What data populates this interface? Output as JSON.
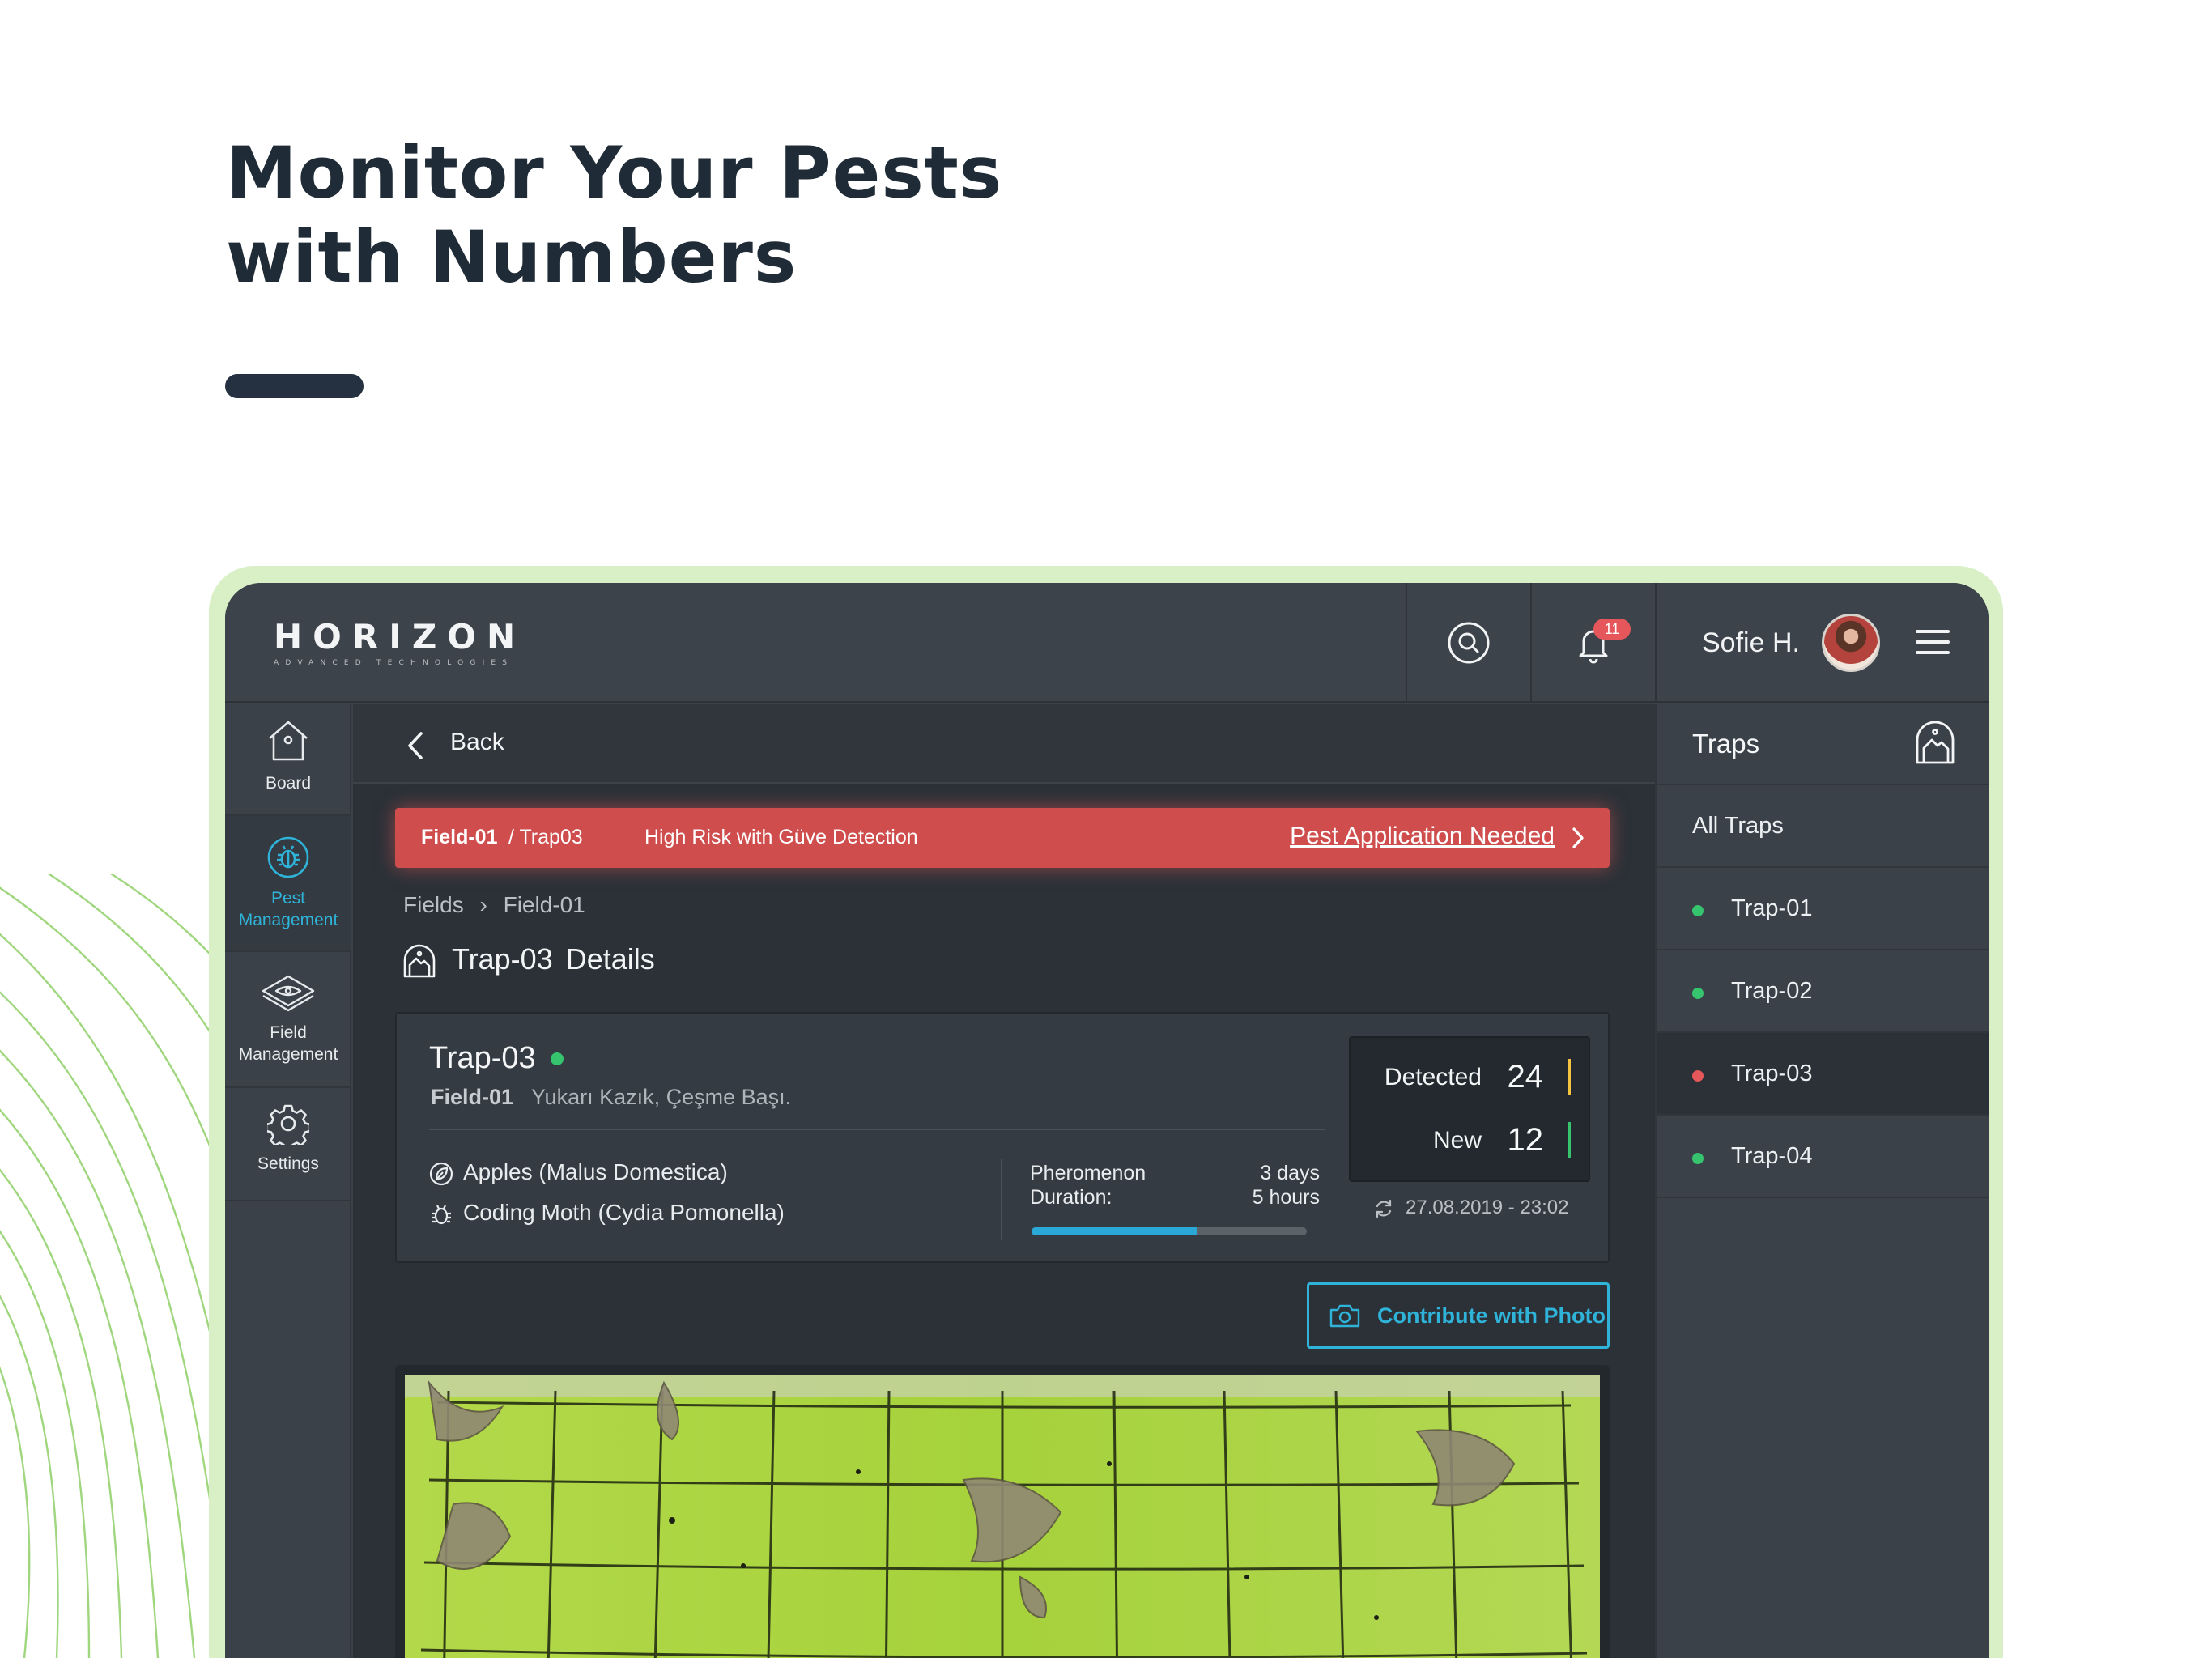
{
  "hero": {
    "title_line1": "Monitor Your Pests",
    "title_line2": "with Numbers"
  },
  "topbar": {
    "logo": "HORIZON",
    "logo_sub": "ADVANCED TECHNOLOGIES",
    "notifications_count": "11",
    "user_name": "Sofie H.",
    "icons": [
      "search-icon",
      "bell-icon",
      "avatar",
      "menu-icon"
    ]
  },
  "nav": {
    "items": [
      {
        "label": "Board",
        "icon": "home-icon",
        "active": false
      },
      {
        "label": "Pest Management",
        "icon": "bug-icon",
        "active": true
      },
      {
        "label": "Field Management",
        "icon": "field-icon",
        "active": false
      },
      {
        "label": "Settings",
        "icon": "gear-icon",
        "active": false
      }
    ]
  },
  "main": {
    "back_label": "Back",
    "alert": {
      "field": "Field-01",
      "trap": "/ Trap03",
      "message": "High Risk with Güve Detection",
      "action": "Pest Application Needed"
    },
    "breadcrumb": [
      "Fields",
      "Field-01"
    ],
    "details_title": "Trap-03",
    "details_suffix": "Details",
    "card": {
      "trap_name": "Trap-03",
      "field": "Field-01",
      "location": "Yukarı Kazık, Çeşme Başı.",
      "crop": "Apples (Malus Domestica)",
      "pest": "Coding Moth (Cydia Pomonella)",
      "pheromenon_label_1": "Pheromenon",
      "pheromenon_label_2": "Duration:",
      "duration_days": "3 days",
      "duration_hours": "5 hours",
      "duration_progress_percent": 60,
      "detected_label": "Detected",
      "detected_value": "24",
      "new_label": "New",
      "new_value": "12",
      "last_sync": "27.08.2019 - 23:02"
    },
    "photo_button": "Contribute with Photo"
  },
  "traps_panel": {
    "title": "Traps",
    "all_label": "All Traps",
    "items": [
      {
        "label": "Trap-01",
        "status": "ok"
      },
      {
        "label": "Trap-02",
        "status": "ok"
      },
      {
        "label": "Trap-03",
        "status": "alert"
      },
      {
        "label": "Trap-04",
        "status": "ok"
      }
    ]
  },
  "colors": {
    "accent": "#2fb3d9",
    "alert": "#cf4d4d",
    "ok": "#36c46f",
    "danger": "#e5575a",
    "detected_bar": "#f5c542",
    "new_bar": "#36c46f",
    "frame": "#d9f0c7"
  }
}
